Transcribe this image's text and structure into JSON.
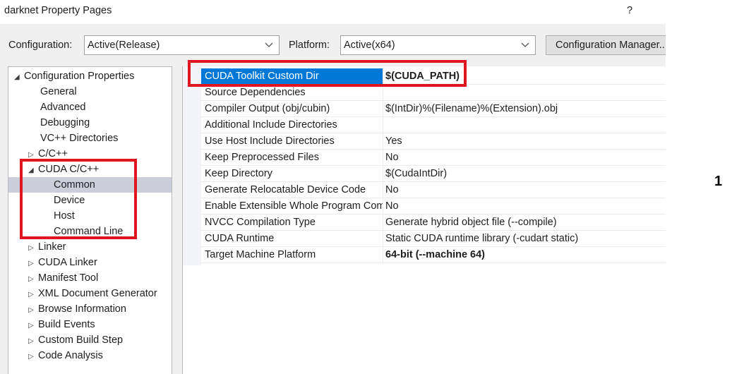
{
  "window": {
    "title": "darknet Property Pages",
    "help": "?"
  },
  "config": {
    "configuration_label": "Configuration:",
    "configuration_value": "Active(Release)",
    "platform_label": "Platform:",
    "platform_value": "Active(x64)",
    "manager_button": "Configuration Manager..."
  },
  "tree": {
    "root": "Configuration Properties",
    "general": "General",
    "advanced": "Advanced",
    "debugging": "Debugging",
    "vcpp": "VC++ Directories",
    "cpp": "C/C++",
    "cuda": "CUDA C/C++",
    "common": "Common",
    "device": "Device",
    "host": "Host",
    "command_line": "Command Line",
    "linker": "Linker",
    "cuda_linker": "CUDA Linker",
    "manifest": "Manifest Tool",
    "xml_doc": "XML Document Generator",
    "browse": "Browse Information",
    "build_events": "Build Events",
    "custom_build": "Custom Build Step",
    "code_analysis": "Code Analysis"
  },
  "properties": [
    {
      "name": "CUDA Toolkit Custom Dir",
      "value": "$(CUDA_PATH)"
    },
    {
      "name": "Source Dependencies",
      "value": ""
    },
    {
      "name": "Compiler Output (obj/cubin)",
      "value": "$(IntDir)%(Filename)%(Extension).obj"
    },
    {
      "name": "Additional Include Directories",
      "value": ""
    },
    {
      "name": "Use Host Include Directories",
      "value": "Yes"
    },
    {
      "name": "Keep Preprocessed Files",
      "value": "No"
    },
    {
      "name": "Keep Directory",
      "value": "$(CudaIntDir)"
    },
    {
      "name": "Generate Relocatable Device Code",
      "value": "No"
    },
    {
      "name": "Enable Extensible Whole Program Compilation",
      "value": "No"
    },
    {
      "name": "NVCC Compilation Type",
      "value": "Generate hybrid object file (--compile)"
    },
    {
      "name": "CUDA Runtime",
      "value": "Static CUDA runtime library (-cudart static)"
    },
    {
      "name": "Target Machine Platform",
      "value": "64-bit (--machine 64)"
    }
  ],
  "annotation": {
    "number": "1"
  },
  "colors": {
    "selection": "#0078d7",
    "tree_selection": "#cccedb",
    "highlight_box": "#e0161e"
  }
}
